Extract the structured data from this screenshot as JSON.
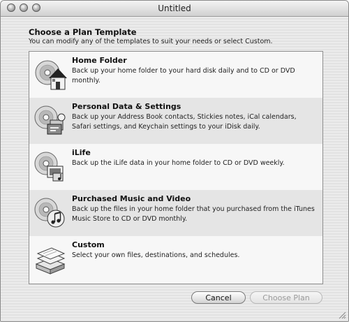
{
  "window": {
    "title": "Untitled"
  },
  "header": {
    "title": "Choose a Plan Template",
    "subtitle": "You can modify any of the templates to suit your needs or select Custom."
  },
  "templates": [
    {
      "name": "Home Folder",
      "icon": "home-folder-icon",
      "description": "Back up your home folder to your hard disk daily and to CD or DVD monthly."
    },
    {
      "name": "Personal Data & Settings",
      "icon": "personal-data-icon",
      "description": "Back up your Address Book contacts, Stickies notes, iCal calendars, Safari settings, and Keychain settings to your iDisk daily."
    },
    {
      "name": "iLife",
      "icon": "ilife-icon",
      "description": "Back up the iLife data in your home folder to CD or DVD weekly."
    },
    {
      "name": "Purchased Music and Video",
      "icon": "purchased-music-icon",
      "description": "Back up the files in your home folder that you purchased from the iTunes Music Store to CD or DVD monthly."
    },
    {
      "name": "Custom",
      "icon": "custom-files-icon",
      "description": "Select your own files, destinations, and schedules."
    }
  ],
  "buttons": {
    "cancel": "Cancel",
    "choose": "Choose Plan"
  }
}
